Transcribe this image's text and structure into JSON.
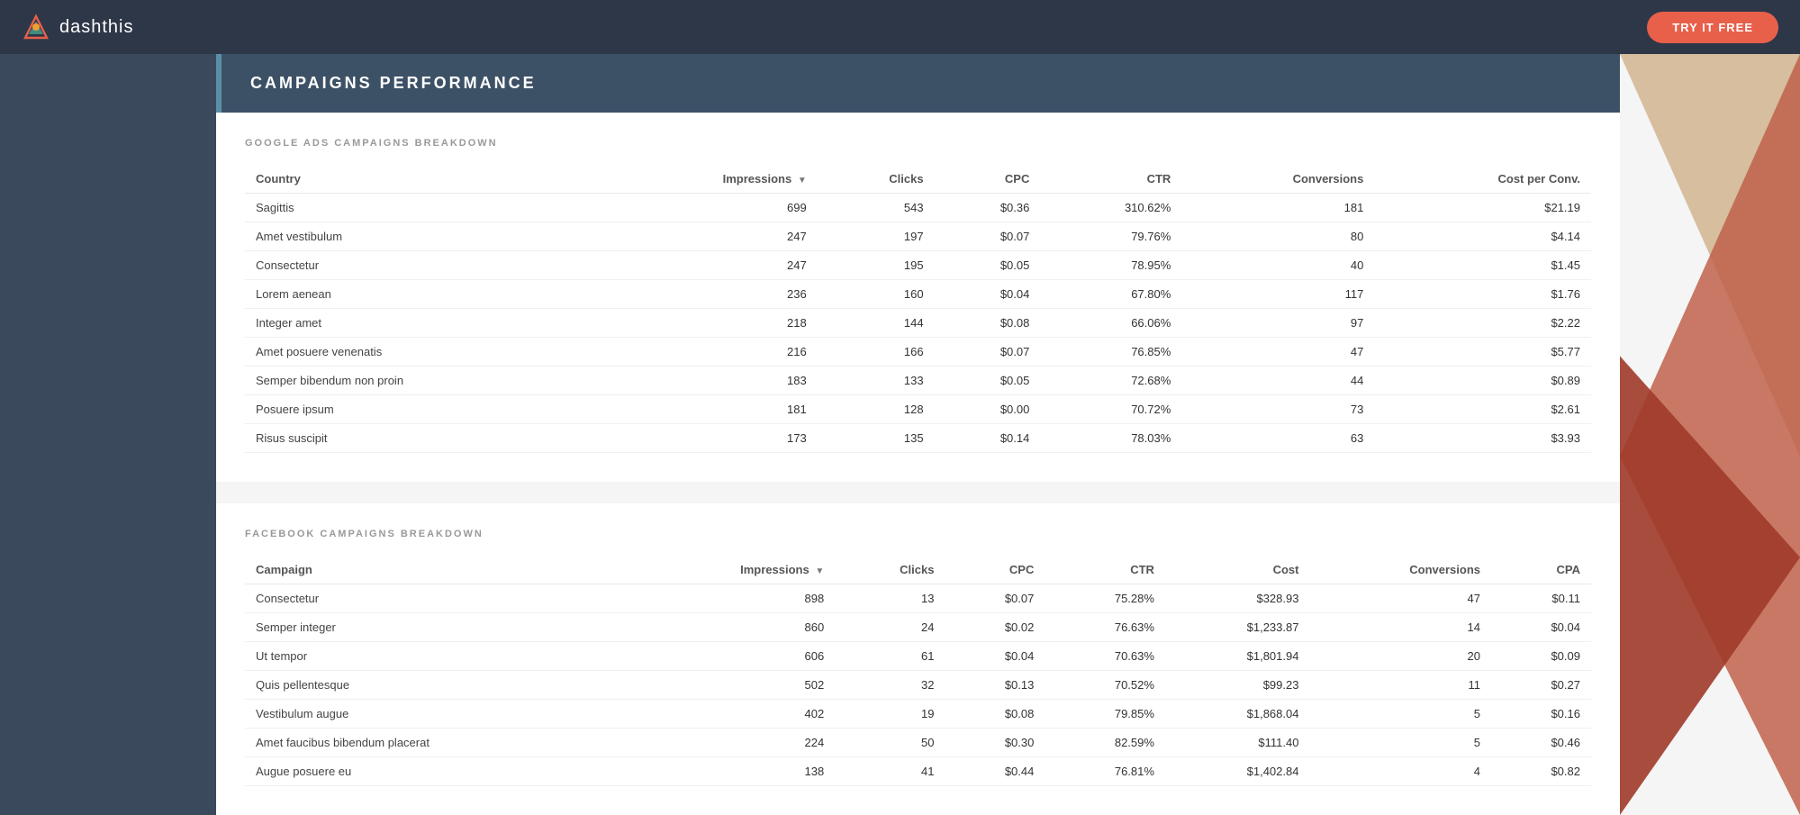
{
  "header": {
    "logo_text": "dashthis",
    "try_free_label": "TRY IT FREE"
  },
  "campaigns_section": {
    "title": "CAMPAIGNS PERFORMANCE",
    "google_section": {
      "label": "GOOGLE ADS CAMPAIGNS BREAKDOWN",
      "columns": [
        "Country",
        "Impressions",
        "Clicks",
        "CPC",
        "CTR",
        "Conversions",
        "Cost per Conv."
      ],
      "rows": [
        {
          "country": "Sagittis",
          "impressions": "699",
          "clicks": "543",
          "cpc": "$0.36",
          "ctr": "310.62%",
          "conversions": "181",
          "cost_per_conv": "$21.19"
        },
        {
          "country": "Amet vestibulum",
          "impressions": "247",
          "clicks": "197",
          "cpc": "$0.07",
          "ctr": "79.76%",
          "conversions": "80",
          "cost_per_conv": "$4.14"
        },
        {
          "country": "Consectetur",
          "impressions": "247",
          "clicks": "195",
          "cpc": "$0.05",
          "ctr": "78.95%",
          "conversions": "40",
          "cost_per_conv": "$1.45"
        },
        {
          "country": "Lorem aenean",
          "impressions": "236",
          "clicks": "160",
          "cpc": "$0.04",
          "ctr": "67.80%",
          "conversions": "117",
          "cost_per_conv": "$1.76"
        },
        {
          "country": "Integer amet",
          "impressions": "218",
          "clicks": "144",
          "cpc": "$0.08",
          "ctr": "66.06%",
          "conversions": "97",
          "cost_per_conv": "$2.22"
        },
        {
          "country": "Amet posuere venenatis",
          "impressions": "216",
          "clicks": "166",
          "cpc": "$0.07",
          "ctr": "76.85%",
          "conversions": "47",
          "cost_per_conv": "$5.77"
        },
        {
          "country": "Semper bibendum non proin",
          "impressions": "183",
          "clicks": "133",
          "cpc": "$0.05",
          "ctr": "72.68%",
          "conversions": "44",
          "cost_per_conv": "$0.89"
        },
        {
          "country": "Posuere ipsum",
          "impressions": "181",
          "clicks": "128",
          "cpc": "$0.00",
          "ctr": "70.72%",
          "conversions": "73",
          "cost_per_conv": "$2.61"
        },
        {
          "country": "Risus suscipit",
          "impressions": "173",
          "clicks": "135",
          "cpc": "$0.14",
          "ctr": "78.03%",
          "conversions": "63",
          "cost_per_conv": "$3.93"
        }
      ]
    },
    "facebook_section": {
      "label": "FACEBOOK CAMPAIGNS BREAKDOWN",
      "columns": [
        "Campaign",
        "Impressions",
        "Clicks",
        "CPC",
        "CTR",
        "Cost",
        "Conversions",
        "CPA"
      ],
      "rows": [
        {
          "campaign": "Consectetur",
          "impressions": "898",
          "clicks": "13",
          "cpc": "$0.07",
          "ctr": "75.28%",
          "cost": "$328.93",
          "conversions": "47",
          "cpa": "$0.11"
        },
        {
          "campaign": "Semper integer",
          "impressions": "860",
          "clicks": "24",
          "cpc": "$0.02",
          "ctr": "76.63%",
          "cost": "$1,233.87",
          "conversions": "14",
          "cpa": "$0.04"
        },
        {
          "campaign": "Ut tempor",
          "impressions": "606",
          "clicks": "61",
          "cpc": "$0.04",
          "ctr": "70.63%",
          "cost": "$1,801.94",
          "conversions": "20",
          "cpa": "$0.09"
        },
        {
          "campaign": "Quis pellentesque",
          "impressions": "502",
          "clicks": "32",
          "cpc": "$0.13",
          "ctr": "70.52%",
          "cost": "$99.23",
          "conversions": "11",
          "cpa": "$0.27"
        },
        {
          "campaign": "Vestibulum augue",
          "impressions": "402",
          "clicks": "19",
          "cpc": "$0.08",
          "ctr": "79.85%",
          "cost": "$1,868.04",
          "conversions": "5",
          "cpa": "$0.16"
        },
        {
          "campaign": "Amet faucibus bibendum placerat",
          "impressions": "224",
          "clicks": "50",
          "cpc": "$0.30",
          "ctr": "82.59%",
          "cost": "$111.40",
          "conversions": "5",
          "cpa": "$0.46"
        },
        {
          "campaign": "Augue posuere eu",
          "impressions": "138",
          "clicks": "41",
          "cpc": "$0.44",
          "ctr": "76.81%",
          "cost": "$1,402.84",
          "conversions": "4",
          "cpa": "$0.82"
        }
      ]
    }
  }
}
